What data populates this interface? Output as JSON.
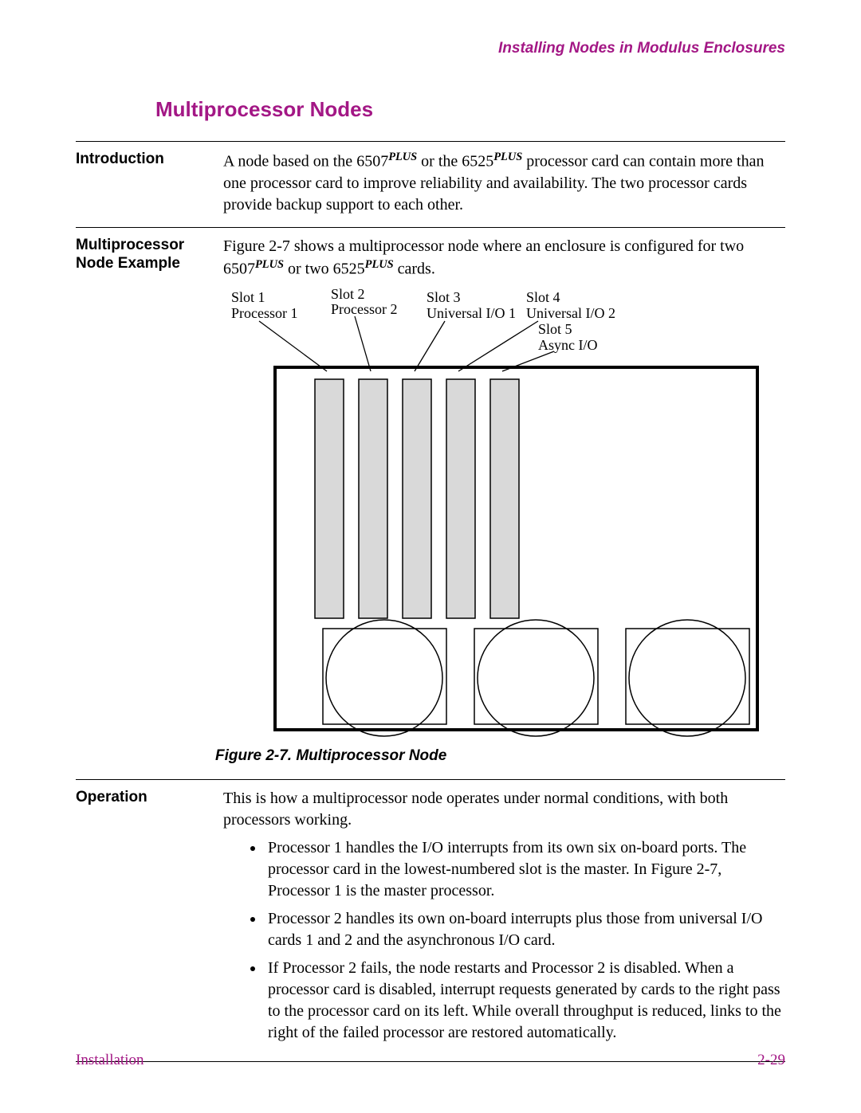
{
  "running_head": "Installing Nodes in Modulus Enclosures",
  "section_title": "Multiprocessor Nodes",
  "intro": {
    "label": "Introduction",
    "text_a": "A node based on the 6507",
    "text_b": " or the 6525",
    "text_c": " processor card can contain more than one processor card to improve reliability and availability. The two processor cards provide backup support to each other.",
    "sup": "PLUS"
  },
  "example": {
    "label": "Multiprocessor Node Example",
    "text_a": "Figure 2-7 shows a multiprocessor node where an enclosure is configured for two 6507",
    "text_b": " or two 6525",
    "text_c": " cards.",
    "sup": "PLUS"
  },
  "figure": {
    "labels": {
      "slot1a": "Slot 1",
      "slot1b": "Processor 1",
      "slot2a": "Slot 2",
      "slot2b": "Processor 2",
      "slot3a": "Slot 3",
      "slot3b": "Universal I/O 1",
      "slot4a": "Slot 4",
      "slot4b": "Universal I/O 2",
      "slot5a": "Slot 5",
      "slot5b": "Async I/O"
    },
    "caption": "Figure 2-7. Multiprocessor Node"
  },
  "operation": {
    "label": "Operation",
    "intro": "This is how a multiprocessor node operates under normal conditions, with both processors working.",
    "b1": "Processor 1 handles the I/O interrupts from its own six on-board ports. The processor card in the lowest-numbered slot is the master. In Figure 2-7, Processor 1 is the master processor.",
    "b2": "Processor 2 handles its own on-board interrupts plus those from universal I/O cards 1 and 2 and the asynchronous I/O card.",
    "b3": "If Processor 2 fails, the node restarts and Processor 2 is disabled. When a processor card is disabled, interrupt requests generated by cards to the right pass to the processor card on its left. While overall throughput is reduced, links to the right of the failed processor are restored automatically."
  },
  "footer": {
    "left": "Installation",
    "right": "2-29"
  }
}
